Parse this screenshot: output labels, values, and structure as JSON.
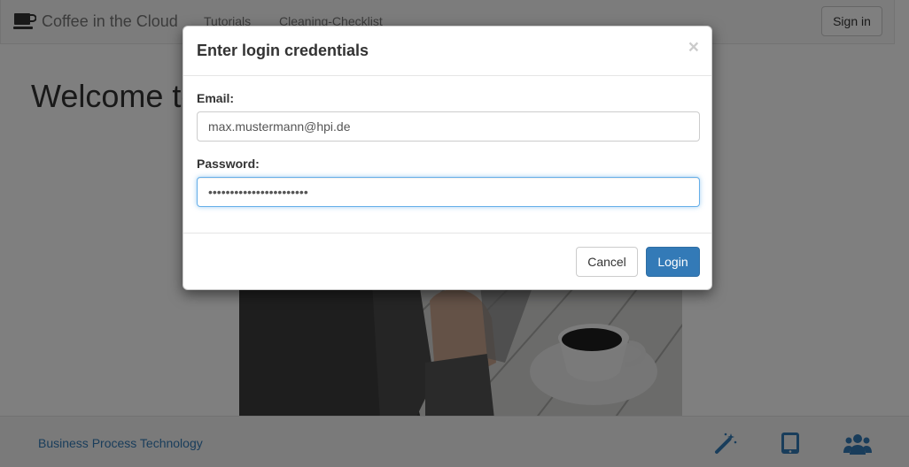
{
  "navbar": {
    "brand": "Coffee in the Cloud",
    "links": [
      "Tutorials",
      "Cleaning-Checklist"
    ],
    "signin_label": "Sign in"
  },
  "page": {
    "heading": "Welcome to Coffee in the Cloud",
    "footer_link": "Business Process Technology",
    "footer_icons": [
      "magic-wand-icon",
      "tablet-icon",
      "users-icon"
    ]
  },
  "modal": {
    "title": "Enter login credentials",
    "close_glyph": "×",
    "email_label": "Email:",
    "email_value": "max.mustermann@hpi.de",
    "password_label": "Password:",
    "password_value": "jdfnk4r5ngfk45jnkfkdf4j",
    "cancel_label": "Cancel",
    "login_label": "Login"
  },
  "colors": {
    "primary": "#337ab7",
    "link": "#337ab7",
    "focus": "#66afe9"
  }
}
